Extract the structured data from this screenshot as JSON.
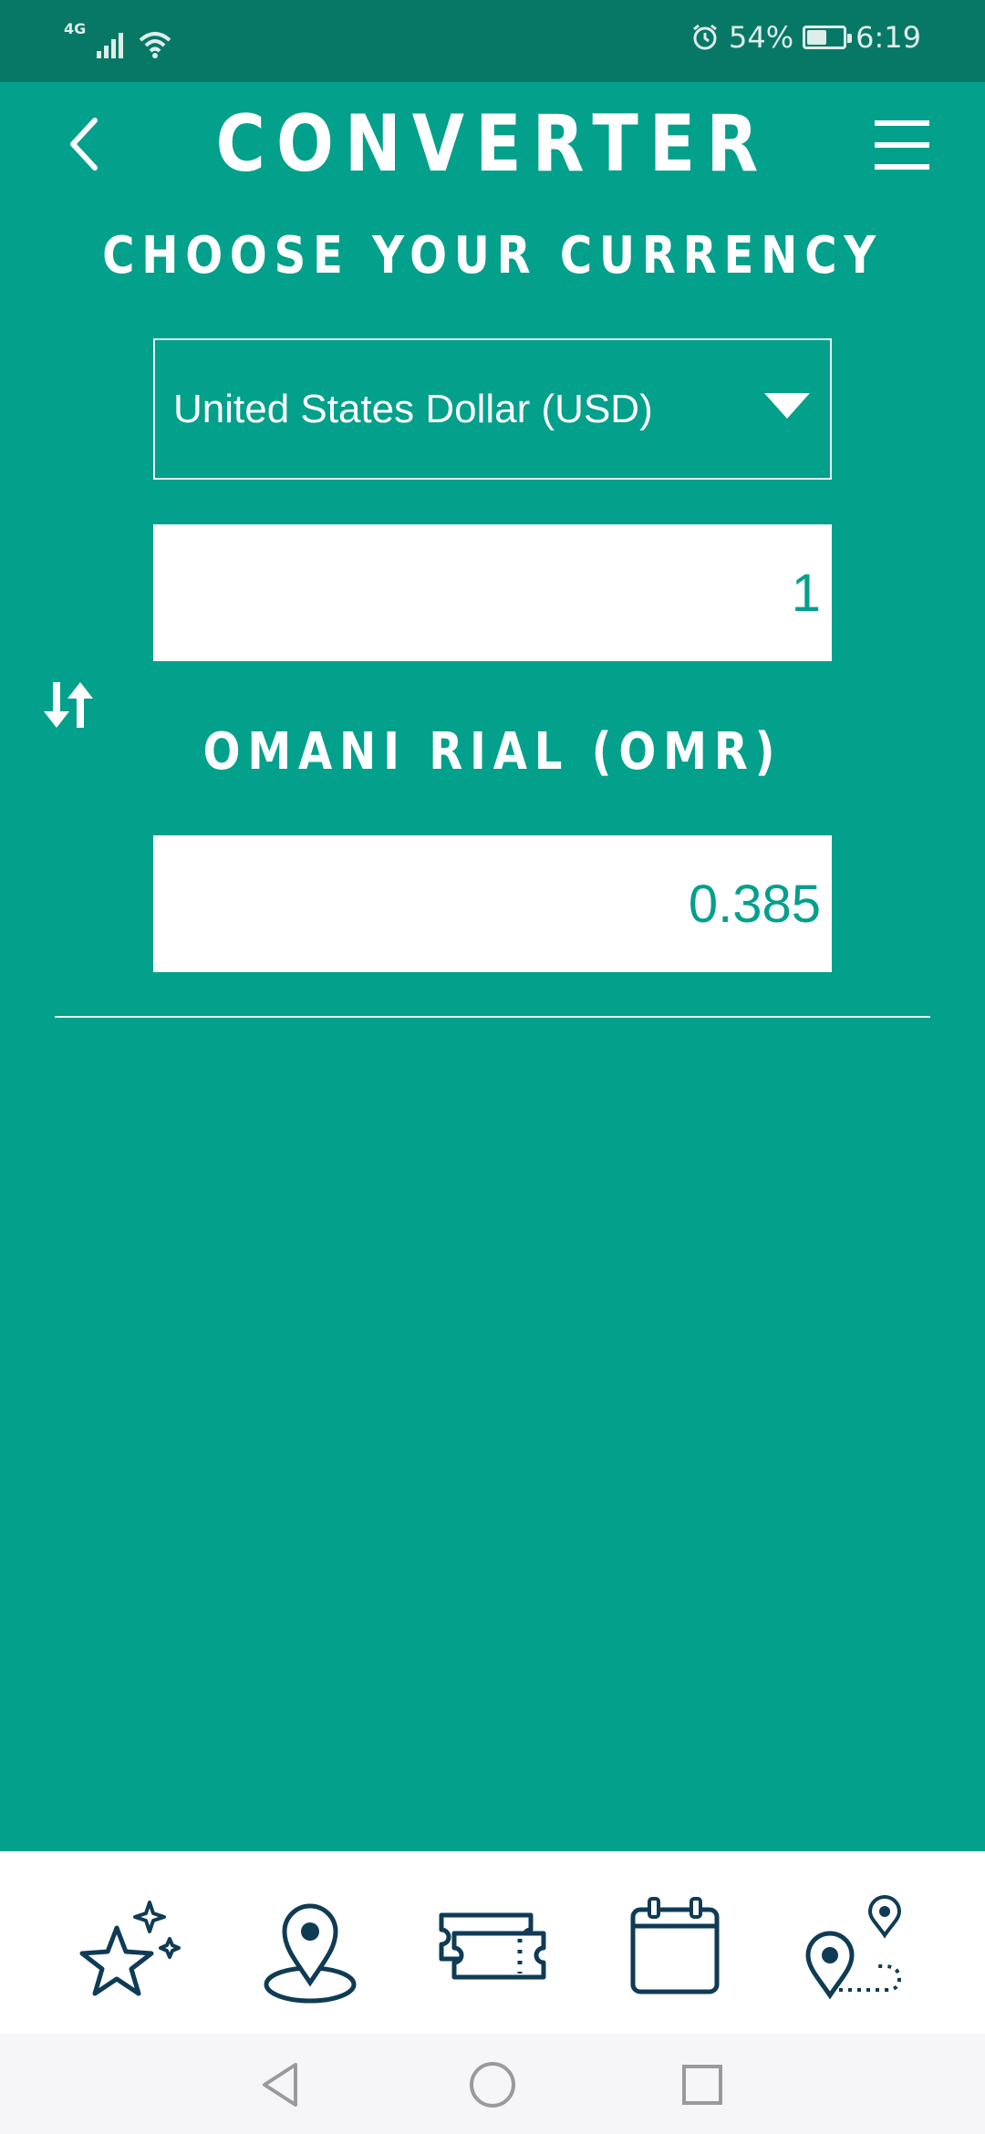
{
  "status_bar": {
    "network": "4G",
    "battery_percent": "54%",
    "battery_level": 0.54,
    "time": "6:19",
    "icons": [
      "signal-icon",
      "wifi-icon",
      "alarm-icon",
      "battery-icon"
    ]
  },
  "header": {
    "title": "CONVERTER",
    "back_icon": "chevron-left-icon",
    "menu_icon": "hamburger-menu-icon"
  },
  "converter": {
    "subtitle": "CHOOSE YOUR CURRENCY",
    "source_currency": "United States Dollar (USD)",
    "source_amount": "1",
    "target_currency_label": "OMANI RIAL (OMR)",
    "target_amount": "0.385",
    "swap_icon": "swap-arrows-icon"
  },
  "bottom_nav": {
    "items": [
      {
        "icon": "stars-icon"
      },
      {
        "icon": "location-pin-icon"
      },
      {
        "icon": "tickets-icon"
      },
      {
        "icon": "calendar-icon"
      },
      {
        "icon": "route-icon"
      }
    ]
  },
  "colors": {
    "primary": "#03a08c",
    "status_bar": "#077866",
    "icon_dark": "#0f3b55"
  }
}
